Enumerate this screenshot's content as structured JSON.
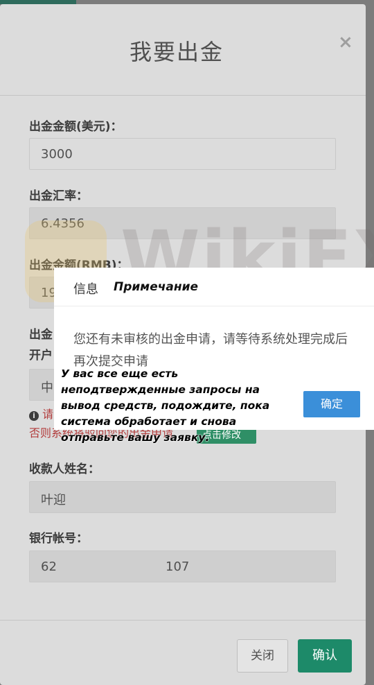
{
  "modal": {
    "title": "我要出金",
    "close_icon": "×",
    "fields": {
      "amount_usd_label": "出金金额(美元)：",
      "amount_usd_value": "3000",
      "rate_label": "出金汇率：",
      "rate_value": "6.4356",
      "amount_rmb_label": "出金金额(RMB)：",
      "amount_rmb_value": "19",
      "bank_label_partial": "出金",
      "account_label_partial": "开户",
      "account_value_partial": "中",
      "warning_partial_1": "请",
      "warning_partial_2": "否则系统将驳回您的出金申请",
      "modify_button": "点击修改",
      "payee_label": "收款人姓名：",
      "payee_value": "叶迎",
      "bank_account_label": "银行帐号：",
      "bank_account_start": "62",
      "bank_account_end": "107"
    },
    "footer": {
      "close_button": "关闭",
      "confirm_button": "确认"
    }
  },
  "watermark": {
    "text": "WikiFX"
  },
  "dialog": {
    "title": "信息",
    "title_translation": "Примечание",
    "message": "您还有未审核的出金申请，请等待系统处理完成后再次提交申请",
    "message_translation": "У вас все еще есть неподтвержденные запросы на вывод средств, подождите, пока система обработает и снова отправьте вашу заявку.",
    "ok_button": "确定"
  },
  "colors": {
    "dialog_ok": "#3b8fd9",
    "confirm_green": "#1d8a69",
    "warning_red": "#b23b3b"
  }
}
